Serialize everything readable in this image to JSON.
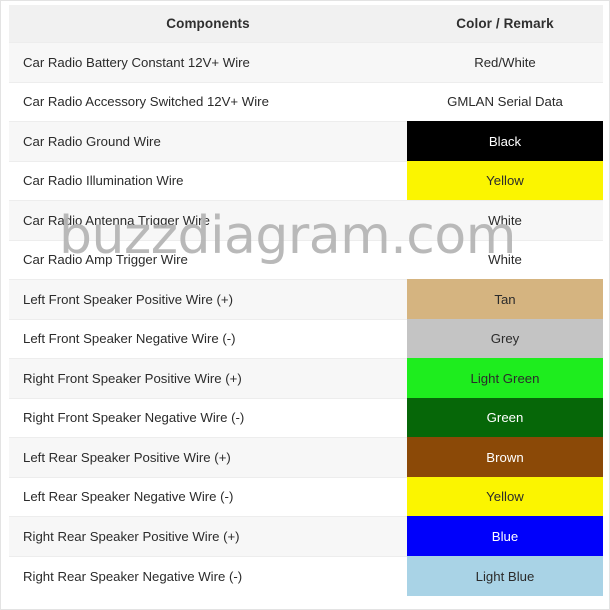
{
  "table": {
    "headers": {
      "components": "Components",
      "color_remark": "Color / Remark"
    },
    "rows": [
      {
        "component": "Car Radio Battery Constant 12V+ Wire",
        "color_label": "Red/White",
        "swatch": null,
        "text_color": "#2b2b2b"
      },
      {
        "component": "Car Radio Accessory Switched 12V+ Wire",
        "color_label": "GMLAN Serial Data",
        "swatch": null,
        "text_color": "#2b2b2b"
      },
      {
        "component": "Car Radio Ground Wire",
        "color_label": "Black",
        "swatch": "#000000",
        "text_color": "#ffffff"
      },
      {
        "component": "Car Radio Illumination Wire",
        "color_label": "Yellow",
        "swatch": "#fbf500",
        "text_color": "#2b2b2b"
      },
      {
        "component": "Car Radio Antenna Trigger Wire",
        "color_label": "White",
        "swatch": null,
        "text_color": "#2b2b2b"
      },
      {
        "component": "Car Radio Amp Trigger Wire",
        "color_label": "White",
        "swatch": null,
        "text_color": "#2b2b2b"
      },
      {
        "component": "Left Front Speaker Positive Wire (+)",
        "color_label": "Tan",
        "swatch": "#d5b480",
        "text_color": "#2b2b2b"
      },
      {
        "component": "Left Front Speaker Negative Wire (-)",
        "color_label": "Grey",
        "swatch": "#c4c4c4",
        "text_color": "#2b2b2b"
      },
      {
        "component": "Right Front Speaker Positive Wire (+)",
        "color_label": "Light Green",
        "swatch": "#1eed1e",
        "text_color": "#2b2b2b"
      },
      {
        "component": "Right Front Speaker Negative Wire (-)",
        "color_label": "Green",
        "swatch": "#066708",
        "text_color": "#ffffff"
      },
      {
        "component": "Left Rear Speaker Positive Wire (+)",
        "color_label": "Brown",
        "swatch": "#8b4907",
        "text_color": "#ffffff"
      },
      {
        "component": "Left Rear Speaker Negative Wire (-)",
        "color_label": "Yellow",
        "swatch": "#fbf500",
        "text_color": "#2b2b2b"
      },
      {
        "component": "Right Rear Speaker Positive Wire (+)",
        "color_label": "Blue",
        "swatch": "#0000fb",
        "text_color": "#ffffff"
      },
      {
        "component": "Right Rear Speaker Negative Wire (-)",
        "color_label": "Light Blue",
        "swatch": "#a9d3e6",
        "text_color": "#2b2b2b"
      }
    ]
  },
  "watermark": {
    "text": "buzzdiagram.com"
  }
}
